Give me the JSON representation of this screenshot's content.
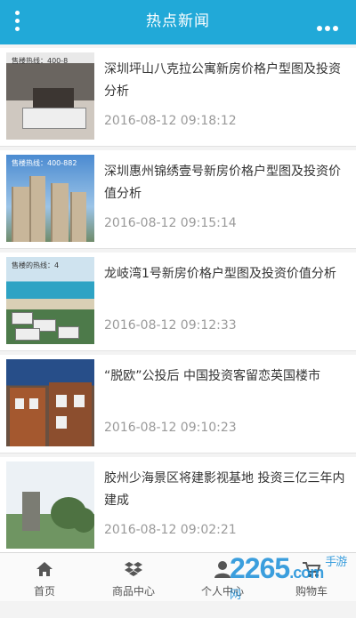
{
  "header": {
    "title": "热点新闻"
  },
  "news": [
    {
      "tag": "售楼热线：400-8",
      "headline": "深圳坪山八克拉公寓新房价格户型图及投资分析",
      "time": "2016-08-12 09:18:12"
    },
    {
      "tag": "售楼热线：400-882",
      "headline": "深圳惠州锦绣壹号新房价格户型图及投资价值分析",
      "time": "2016-08-12 09:15:14"
    },
    {
      "tag": "售楼的热线：4",
      "headline": "龙岐湾1号新房价格户型图及投资价值分析",
      "time": "2016-08-12 09:12:33"
    },
    {
      "tag": "",
      "headline": "“脱欧”公投后 中国投资客留恋英国楼市",
      "time": "2016-08-12 09:10:23"
    },
    {
      "tag": "",
      "headline": "胶州少海景区将建影视基地 投资三亿三年内建成",
      "time": "2016-08-12 09:02:21"
    }
  ],
  "tabs": [
    {
      "label": "首页",
      "icon": "home-icon"
    },
    {
      "label": "商品中心",
      "icon": "dropbox-icon"
    },
    {
      "label": "个人中心",
      "icon": "user-icon"
    },
    {
      "label": "购物车",
      "icon": "cart-icon"
    }
  ],
  "watermark": {
    "main": "2265",
    "suffix": ".com",
    "small": "手游网"
  }
}
